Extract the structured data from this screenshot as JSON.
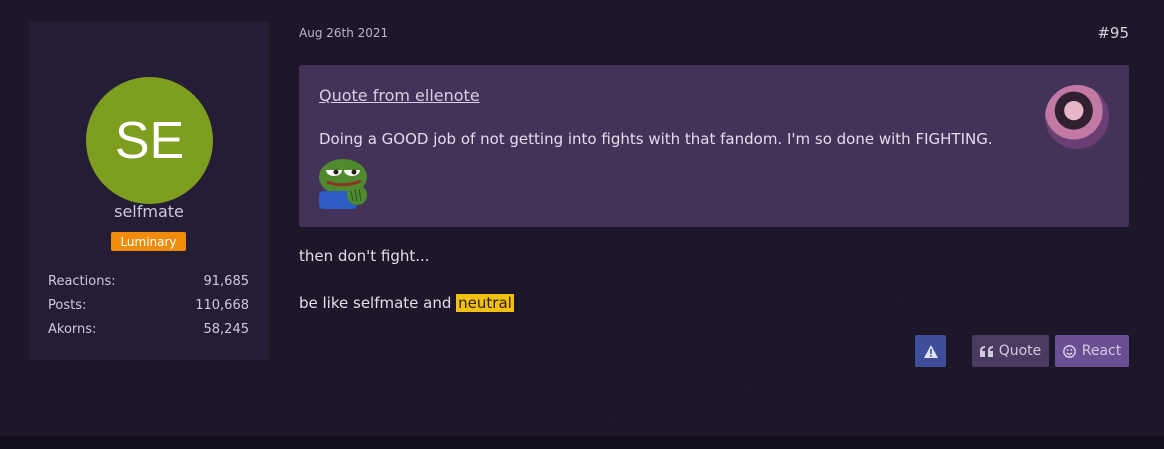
{
  "user": {
    "initials": "SE",
    "name": "selfmate",
    "rank": "Luminary",
    "avatar_color": "#7e9e20",
    "rank_color": "#f08c0a",
    "stats": [
      {
        "label": "Reactions:",
        "value": "91,685"
      },
      {
        "label": "Posts:",
        "value": "110,668"
      },
      {
        "label": "Akorns:",
        "value": "58,245"
      }
    ]
  },
  "post": {
    "date": "Aug 26th 2021",
    "number": "#95",
    "quote": {
      "title": "Quote from ellenote",
      "text": "Doing a GOOD job of not getting into fights with that fandom. I'm so done with FIGHTING."
    },
    "line1": "then don't fight...",
    "line2_prefix": "be like selfmate and ",
    "line2_highlight": "neutral"
  },
  "actions": {
    "report_icon": "warning-icon",
    "quote_label": "Quote",
    "quote_icon": "quote-icon",
    "react_label": "React",
    "react_icon": "smile-icon"
  },
  "colors": {
    "background": "#1d1729",
    "card": "#251d36",
    "quote_box": "#433359",
    "highlight": "#f2c012",
    "report_button": "#3e4e9a",
    "quote_button": "#4a3b60",
    "react_button": "#6b4f93"
  }
}
